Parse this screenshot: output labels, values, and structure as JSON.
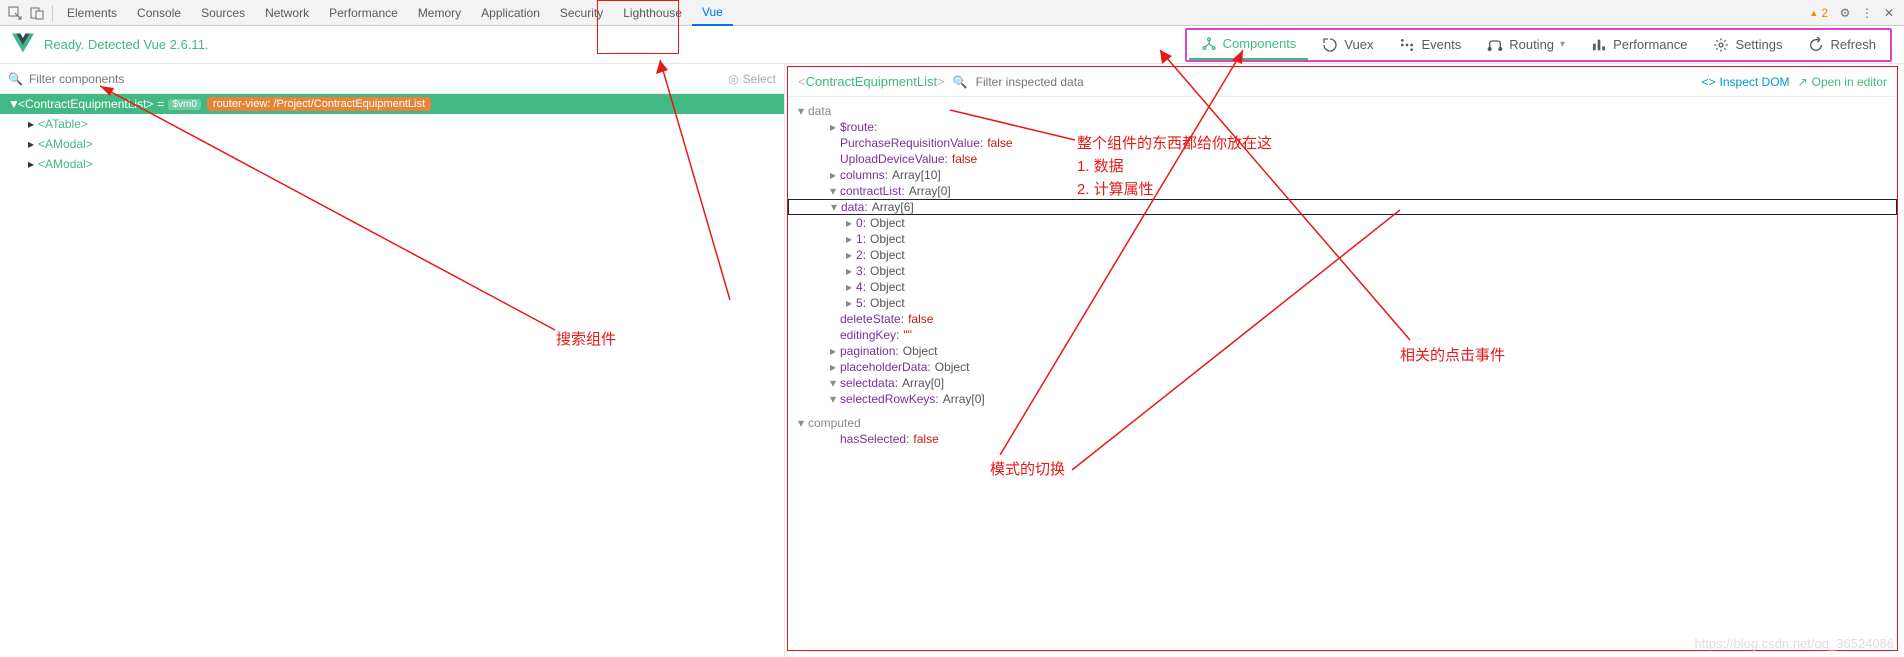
{
  "devtools": {
    "tabs": [
      "Elements",
      "Console",
      "Sources",
      "Network",
      "Performance",
      "Memory",
      "Application",
      "Security",
      "Lighthouse",
      "Vue"
    ],
    "active_tab": "Vue",
    "warnings": "2"
  },
  "vue": {
    "status": "Ready. Detected Vue 2.6.11.",
    "modes": {
      "components": "Components",
      "vuex": "Vuex",
      "events": "Events",
      "routing": "Routing",
      "performance": "Performance",
      "settings": "Settings",
      "refresh": "Refresh"
    },
    "active_mode": "Components"
  },
  "left": {
    "filter_placeholder": "Filter components",
    "select_label": "Select",
    "tree": {
      "root": "ContractEquipmentList",
      "vm": "$vm0",
      "router_view": "router-view: /Project/ContractEquipmentList",
      "children": [
        "ATable",
        "AModal",
        "AModal"
      ]
    }
  },
  "right": {
    "component": "ContractEquipmentList",
    "filter_placeholder": "Filter inspected data",
    "inspect_dom": "Inspect DOM",
    "open_editor": "Open in editor",
    "data": {
      "section": "data",
      "items": [
        {
          "k": "$route",
          "t": "caret"
        },
        {
          "k": "PurchaseRequisitionValue",
          "v": "false",
          "t": "bool"
        },
        {
          "k": "UploadDeviceValue",
          "v": "false",
          "t": "bool"
        },
        {
          "k": "columns",
          "v": "Array[10]",
          "t": "arr"
        },
        {
          "k": "contractList",
          "v": "Array[0]",
          "t": "arr-open"
        },
        {
          "k": "data",
          "v": "Array[6]",
          "t": "arr-open-box"
        },
        {
          "k": "0",
          "v": "Object",
          "t": "obj",
          "lvl": 3
        },
        {
          "k": "1",
          "v": "Object",
          "t": "obj",
          "lvl": 3
        },
        {
          "k": "2",
          "v": "Object",
          "t": "obj",
          "lvl": 3
        },
        {
          "k": "3",
          "v": "Object",
          "t": "obj",
          "lvl": 3
        },
        {
          "k": "4",
          "v": "Object",
          "t": "obj",
          "lvl": 3
        },
        {
          "k": "5",
          "v": "Object",
          "t": "obj",
          "lvl": 3
        },
        {
          "k": "deleteState",
          "v": "false",
          "t": "bool"
        },
        {
          "k": "editingKey",
          "v": "\"\"",
          "t": "str"
        },
        {
          "k": "pagination",
          "v": "Object",
          "t": "obj-c"
        },
        {
          "k": "placeholderData",
          "v": "Object",
          "t": "obj-c"
        },
        {
          "k": "selectdata",
          "v": "Array[0]",
          "t": "arr-open"
        },
        {
          "k": "selectedRowKeys",
          "v": "Array[0]",
          "t": "arr-open"
        }
      ],
      "computed_section": "computed",
      "computed": [
        {
          "k": "hasSelected",
          "v": "false",
          "t": "bool"
        }
      ]
    }
  },
  "annotations": {
    "a1": "搜索组件",
    "a2": "整个组件的东西都给你放在这",
    "a2b": "1. 数据",
    "a2c": "2. 计算属性",
    "a3": "模式的切换",
    "a4": "相关的点击事件"
  },
  "watermark": "https://blog.csdn.net/qq_36524086"
}
